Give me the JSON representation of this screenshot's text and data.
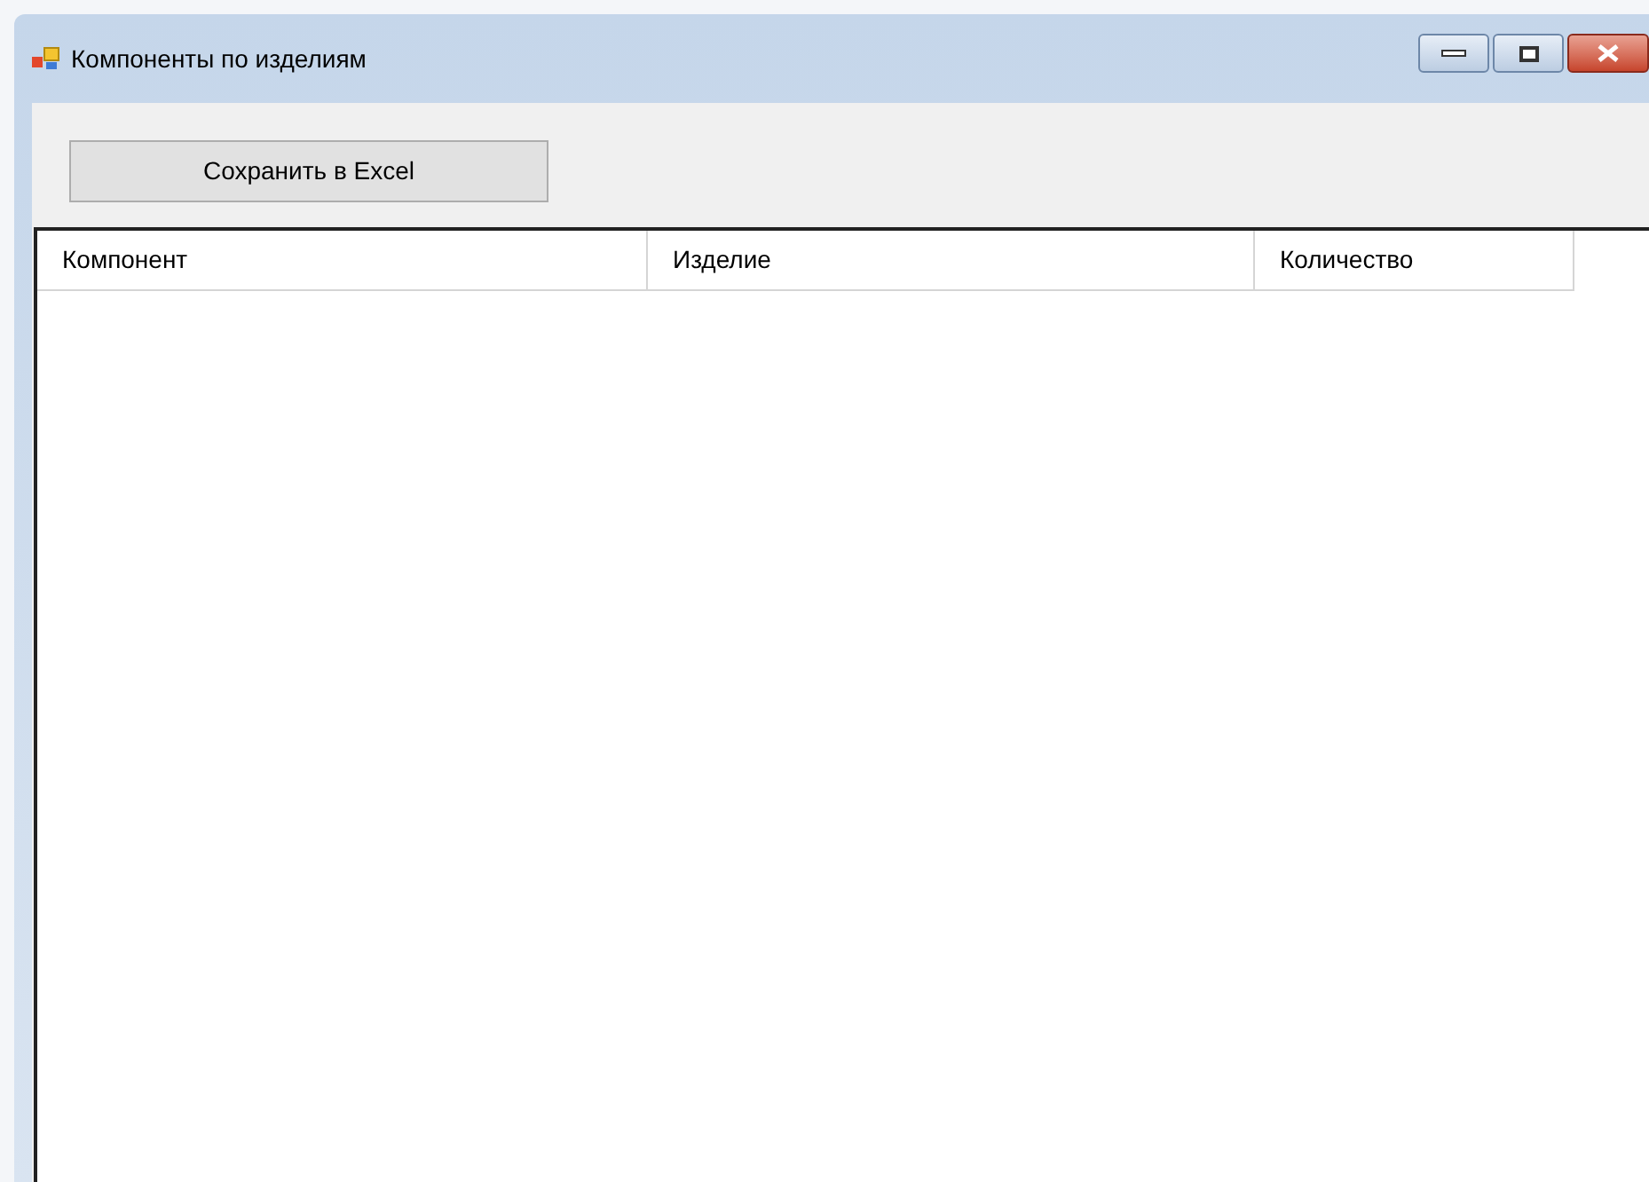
{
  "window": {
    "title": "Компоненты по изделиям"
  },
  "toolbar": {
    "save_button": "Сохранить в Excel"
  },
  "table": {
    "columns": [
      "Компонент",
      "Изделие",
      "Количество"
    ]
  }
}
